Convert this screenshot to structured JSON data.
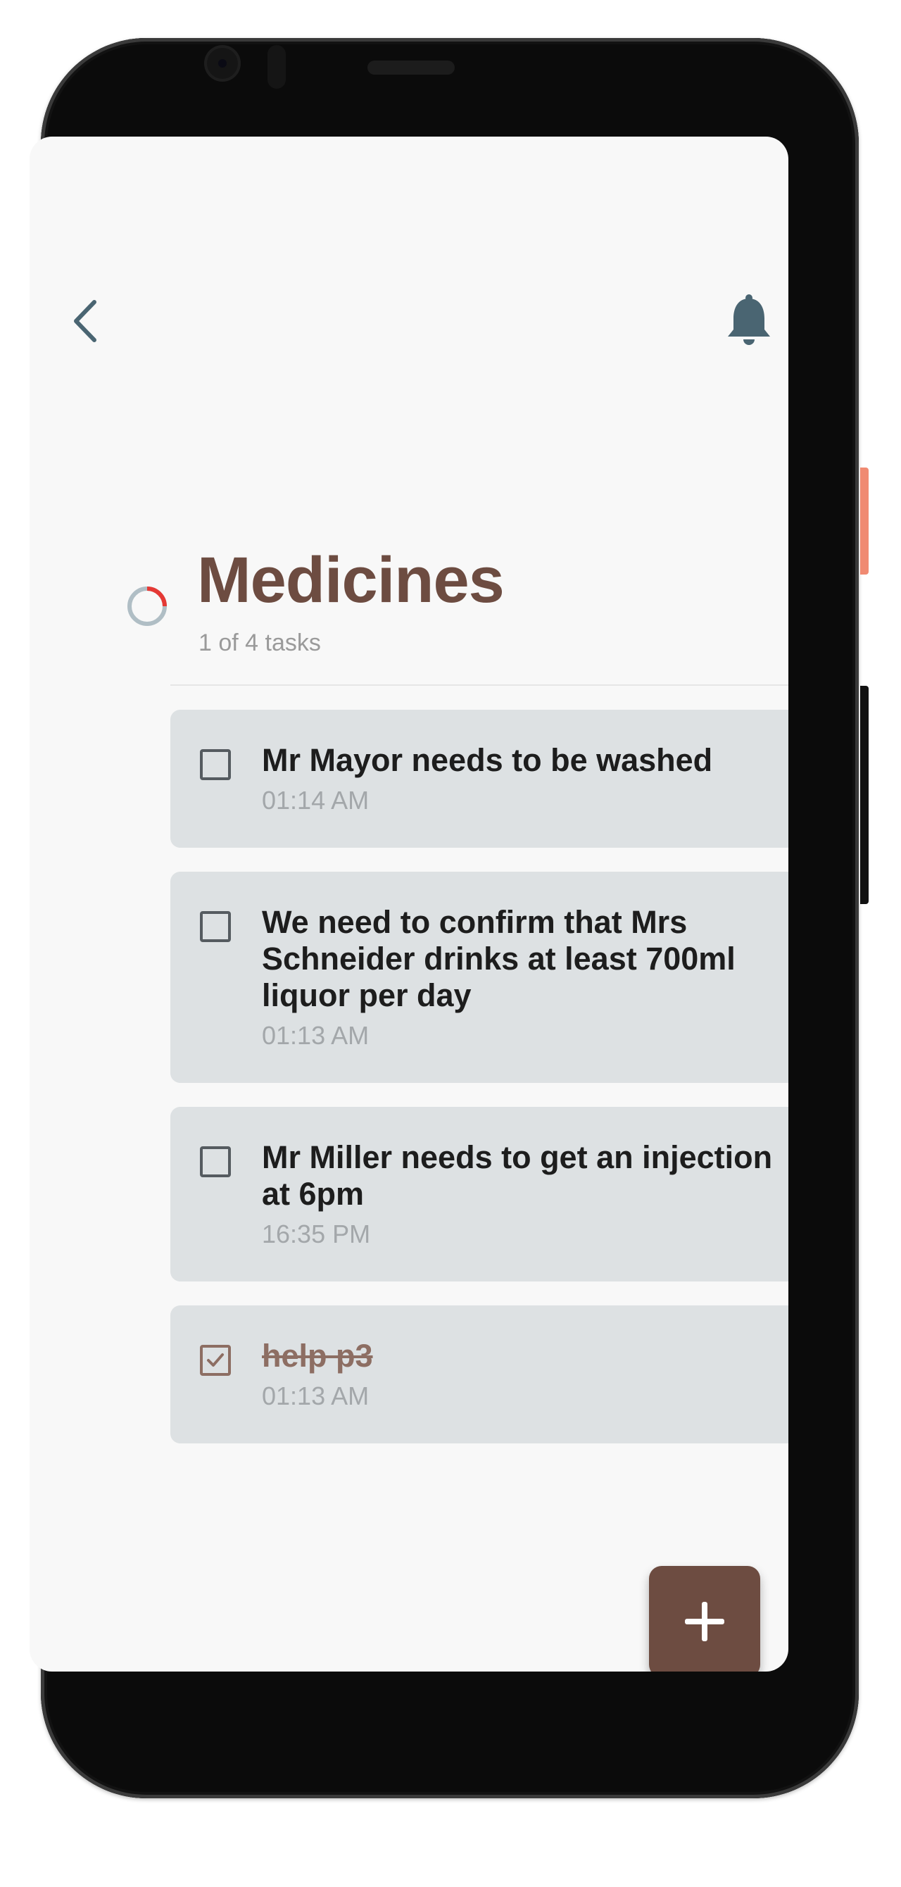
{
  "header": {
    "back_icon": "chevron-left-icon",
    "notification_icon": "bell-icon"
  },
  "list": {
    "title": "Medicines",
    "progress_text": "1 of 4 tasks",
    "progress_fraction": 0.25,
    "progress_color": "#e53935",
    "track_color": "#b0bec5"
  },
  "tasks": [
    {
      "title": "Mr Mayor needs to be washed",
      "time": "01:14 AM",
      "done": false
    },
    {
      "title": "We need to confirm that Mrs Schneider drinks at least 700ml liquor per day",
      "time": "01:13 AM",
      "done": false
    },
    {
      "title": "Mr Miller  needs to get an injection at 6pm",
      "time": "16:35 PM",
      "done": false
    },
    {
      "title": "help p3",
      "time": "01:13 AM",
      "done": true
    }
  ],
  "fab": {
    "icon": "plus-icon"
  },
  "colors": {
    "brand": "#6d4c41",
    "card": "#dde1e3",
    "icon": "#4a6572",
    "background": "#f8f8f8"
  }
}
